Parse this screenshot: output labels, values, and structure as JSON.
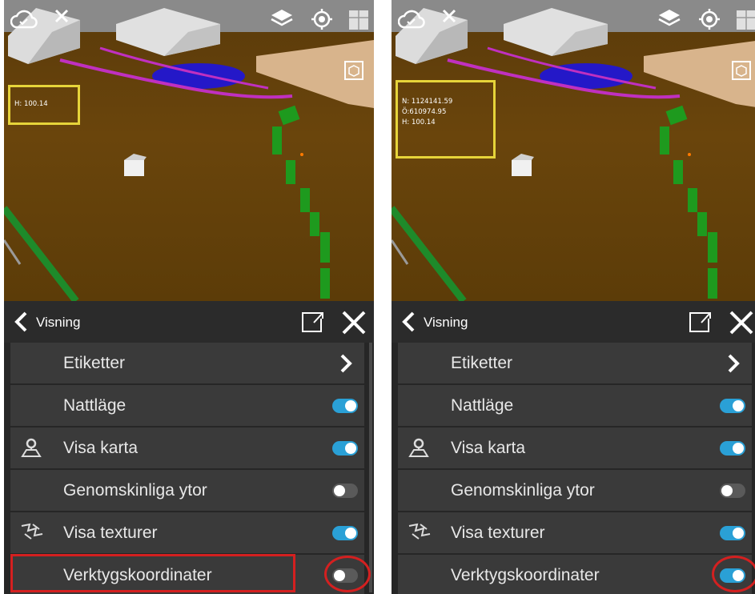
{
  "screens": [
    {
      "id": "before",
      "coordinates": {
        "lines": [
          "H: 100.14"
        ]
      },
      "panel": {
        "back_icon": "chevron-left-icon",
        "title": "Visning",
        "export_icon": "external-link-icon",
        "close_icon": "close-icon",
        "rows": [
          {
            "label": "Etiketter",
            "control": "chevron",
            "icon": ""
          },
          {
            "label": "Nattläge",
            "control": "toggle",
            "state": "on",
            "icon": ""
          },
          {
            "label": "Visa karta",
            "control": "toggle",
            "state": "on",
            "icon": "map-pin-icon"
          },
          {
            "label": "Genomskinliga ytor",
            "control": "toggle",
            "state": "off",
            "icon": ""
          },
          {
            "label": "Visa texturer",
            "control": "toggle",
            "state": "on",
            "icon": "texture-icon"
          },
          {
            "label": "Verktygskoordinater",
            "control": "toggle",
            "state": "off",
            "icon": ""
          }
        ]
      }
    },
    {
      "id": "after",
      "coordinates": {
        "lines": [
          "N: 1124141.59",
          "Ö:610974.95",
          "H: 100.14"
        ]
      },
      "panel": {
        "back_icon": "chevron-left-icon",
        "title": "Visning",
        "export_icon": "external-link-icon",
        "close_icon": "close-icon",
        "rows": [
          {
            "label": "Etiketter",
            "control": "chevron",
            "icon": ""
          },
          {
            "label": "Nattläge",
            "control": "toggle",
            "state": "on",
            "icon": ""
          },
          {
            "label": "Visa karta",
            "control": "toggle",
            "state": "on",
            "icon": "map-pin-icon"
          },
          {
            "label": "Genomskinliga ytor",
            "control": "toggle",
            "state": "off",
            "icon": ""
          },
          {
            "label": "Visa texturer",
            "control": "toggle",
            "state": "on",
            "icon": "texture-icon"
          },
          {
            "label": "Verktygskoordinater",
            "control": "toggle",
            "state": "on",
            "icon": ""
          }
        ]
      }
    }
  ],
  "colors": {
    "toggle_on": "#2aa0d6",
    "toggle_off": "#5a5a5a",
    "highlight": "#d42020",
    "coordinate_frame": "#e6d43a",
    "ground": "#6a450c"
  }
}
